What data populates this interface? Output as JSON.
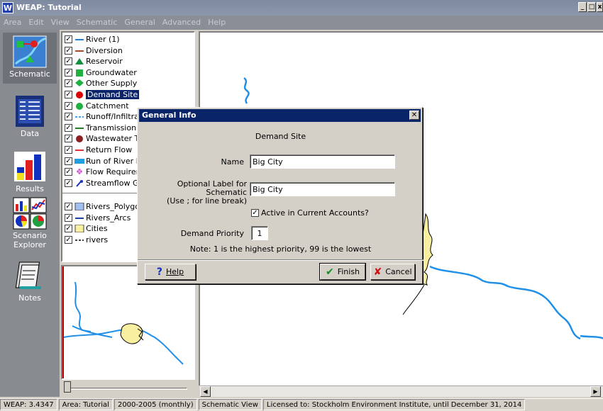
{
  "window": {
    "title": "WEAP: Tutorial",
    "logo": "W"
  },
  "menu": [
    "Area",
    "Edit",
    "View",
    "Schematic",
    "General",
    "Advanced",
    "Help"
  ],
  "sidebar": {
    "items": [
      {
        "label": "Schematic",
        "icon": "schematic-icon"
      },
      {
        "label": "Data",
        "icon": "data-icon"
      },
      {
        "label": "Results",
        "icon": "results-icon"
      },
      {
        "label": "Scenario Explorer",
        "icon": "scenario-explorer-icon"
      },
      {
        "label": "Notes",
        "icon": "notes-icon"
      }
    ]
  },
  "layers": {
    "items": [
      {
        "label": "River (1)",
        "color": "#2e7bd6",
        "symbol": "line"
      },
      {
        "label": "Diversion",
        "color": "#a05020",
        "symbol": "line"
      },
      {
        "label": "Reservoir",
        "color": "#109040",
        "symbol": "triangle"
      },
      {
        "label": "Groundwater",
        "color": "#20b040",
        "symbol": "square"
      },
      {
        "label": "Other Supply",
        "color": "#20b040",
        "symbol": "diamond"
      },
      {
        "label": "Demand Site",
        "color": "#e00000",
        "symbol": "circle"
      },
      {
        "label": "Catchment",
        "color": "#20b040",
        "symbol": "circle"
      },
      {
        "label": "Runoff/Infiltrati",
        "color": "#40a0ff",
        "symbol": "dash"
      },
      {
        "label": "Transmission Lir",
        "color": "#208030",
        "symbol": "line"
      },
      {
        "label": "Wastewater Tre",
        "color": "#8b2020",
        "symbol": "circle"
      },
      {
        "label": "Return Flow",
        "color": "#e03030",
        "symbol": "line"
      },
      {
        "label": "Run of River Hy",
        "color": "#20a0e0",
        "symbol": "rect"
      },
      {
        "label": "Flow Requireme",
        "color": "#d040d0",
        "symbol": "star"
      },
      {
        "label": "Streamflow Gau",
        "color": "#2030c0",
        "symbol": "flag"
      }
    ],
    "gis": [
      {
        "label": "Rivers_Polygon",
        "color": "#a0c0f0",
        "symbol": "box"
      },
      {
        "label": "Rivers_Arcs",
        "color": "#2040a0",
        "symbol": "line"
      },
      {
        "label": "Cities",
        "color": "#f8f0a0",
        "symbol": "box"
      },
      {
        "label": "rivers",
        "color": "#404040",
        "symbol": "dash"
      }
    ]
  },
  "dialog": {
    "title": "General Info",
    "heading": "Demand Site",
    "name_label": "Name",
    "name_value": "Big City",
    "optional_label_line1": "Optional Label for Schematic",
    "optional_label_line2": "(Use ; for line break)",
    "optional_value": "Big City",
    "active_label": "Active in Current Accounts?",
    "active_checked": true,
    "priority_label": "Demand Priority",
    "priority_value": "1",
    "note": "Note: 1 is the highest priority, 99 is the lowest",
    "help_button": "Help",
    "finish_button": "Finish",
    "cancel_button": "Cancel"
  },
  "status": [
    "WEAP: 3.4347",
    "Area: Tutorial",
    "2000-2005 (monthly)",
    "Schematic View",
    "Licensed to: Stockholm Environment Institute, until December 31, 2014"
  ],
  "colors": {
    "river": "#1f8fe8",
    "city_fill": "#f8f0a0",
    "titlebar": "#0a246a"
  }
}
